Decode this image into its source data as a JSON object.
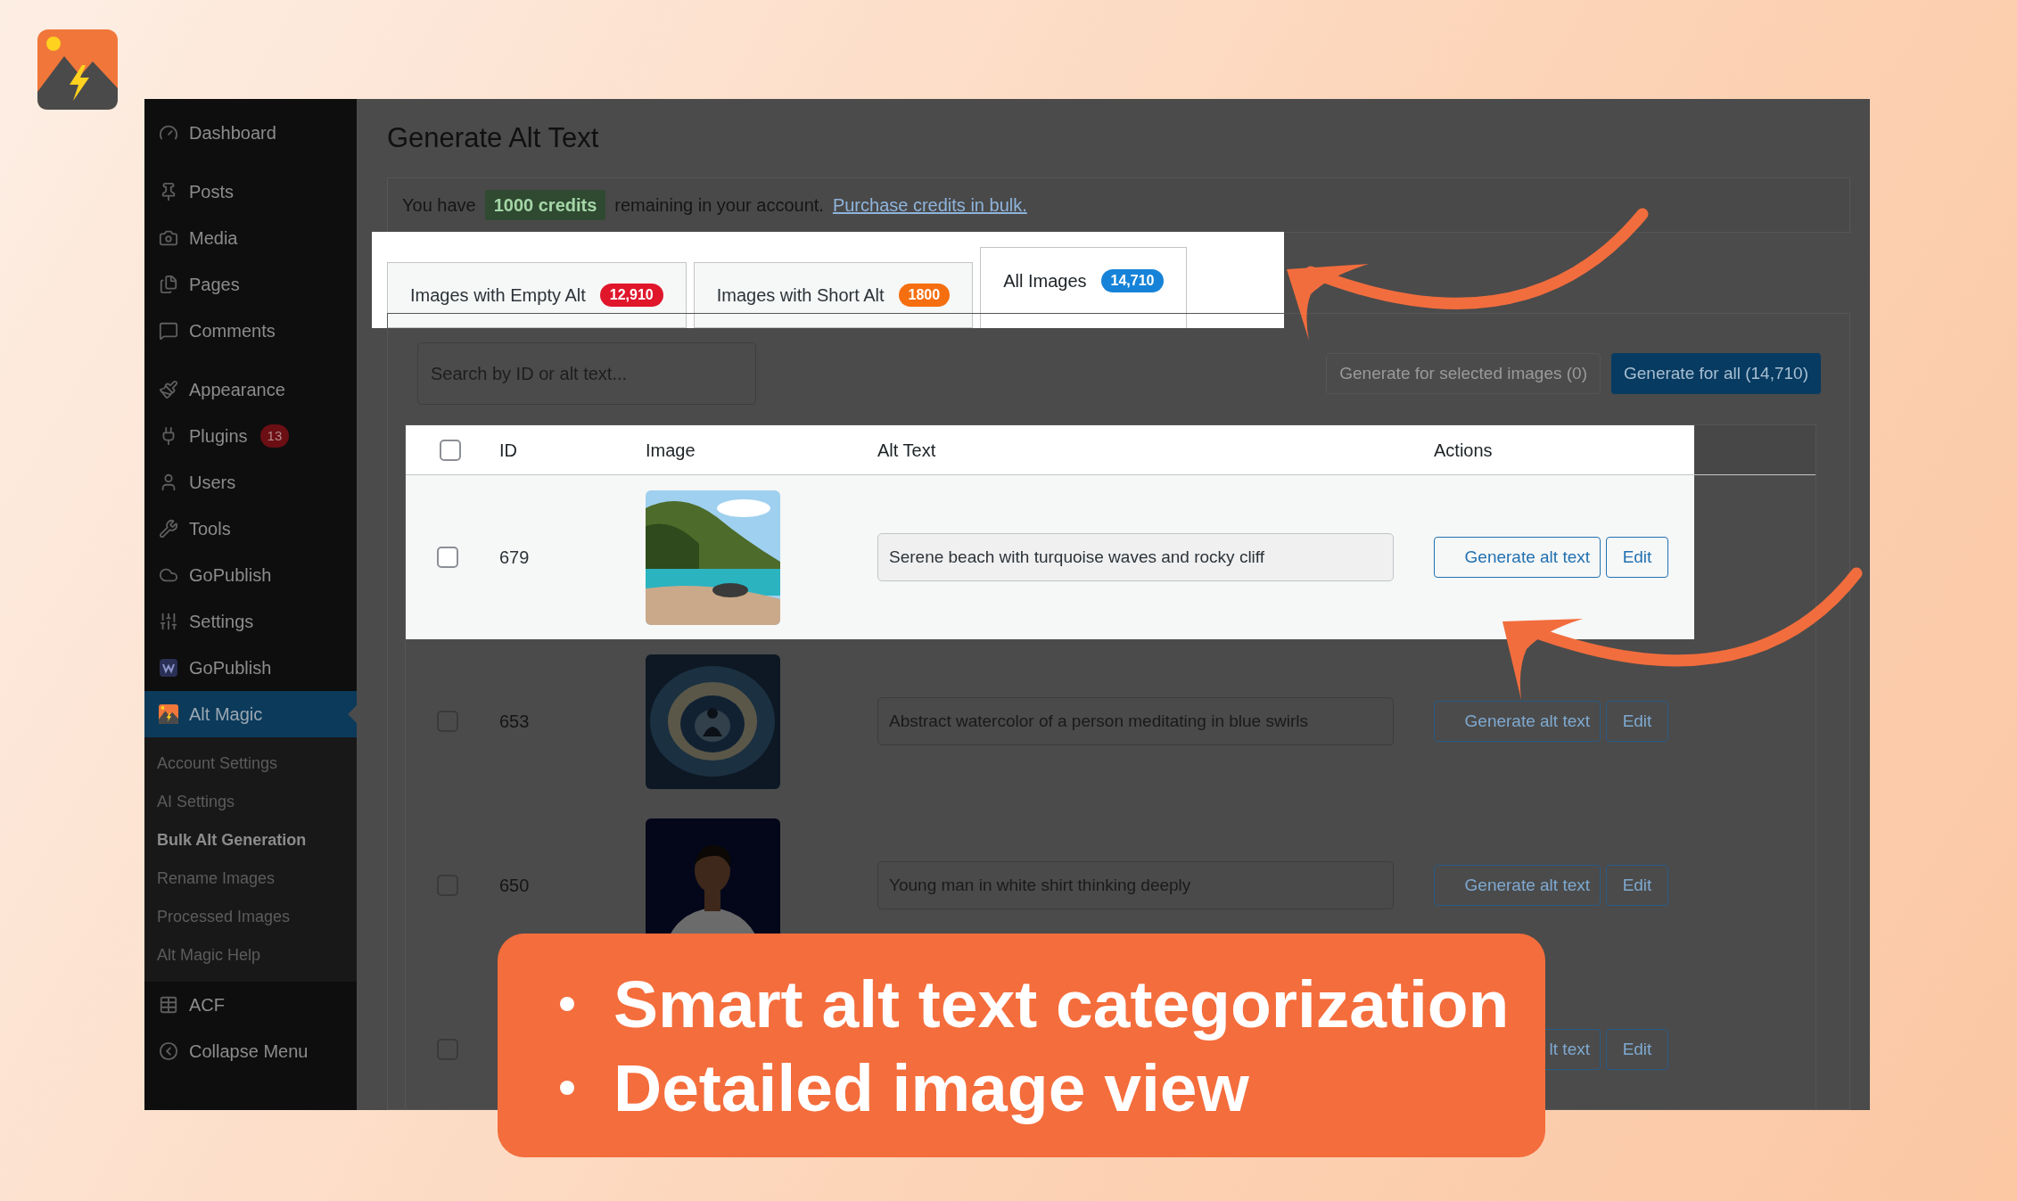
{
  "sidebar": {
    "items": [
      {
        "label": "Dashboard",
        "selected": false
      },
      {
        "label": "Posts",
        "selected": false
      },
      {
        "label": "Media",
        "selected": false
      },
      {
        "label": "Pages",
        "selected": false
      },
      {
        "label": "Comments",
        "selected": false
      },
      {
        "label": "Appearance",
        "selected": false
      },
      {
        "label": "Plugins",
        "selected": false,
        "badge": "13"
      },
      {
        "label": "Users",
        "selected": false
      },
      {
        "label": "Tools",
        "selected": false
      },
      {
        "label": "GoPublish",
        "selected": false
      },
      {
        "label": "Settings",
        "selected": false
      },
      {
        "label": "GoPublish",
        "selected": false
      },
      {
        "label": "Alt Magic",
        "selected": true,
        "submenu": [
          {
            "label": "Account Settings",
            "selected": false
          },
          {
            "label": "AI Settings",
            "selected": false
          },
          {
            "label": "Bulk Alt Generation",
            "selected": true
          },
          {
            "label": "Rename Images",
            "selected": false
          },
          {
            "label": "Processed Images",
            "selected": false
          },
          {
            "label": "Alt Magic Help",
            "selected": false
          }
        ]
      },
      {
        "label": "ACF",
        "selected": false
      },
      {
        "label": "Collapse Menu",
        "selected": false
      }
    ]
  },
  "page": {
    "title": "Generate Alt Text"
  },
  "notice": {
    "before": "You have",
    "credits": "1000 credits",
    "after": "remaining in your account.",
    "link": "Purchase credits in bulk."
  },
  "tabs": {
    "highlighted": true,
    "items": [
      {
        "label": "Images with Empty Alt",
        "count": "12,910",
        "color": "#e0162b",
        "selected": false
      },
      {
        "label": "Images with Short Alt",
        "count": "1800",
        "color": "#f56e0f",
        "selected": false
      },
      {
        "label": "All Images",
        "count": "14,710",
        "color": "#1683d8",
        "selected": true
      }
    ]
  },
  "search": {
    "placeholder": "Search by ID or alt text..."
  },
  "buttons": [
    {
      "label": "Generate for selected images (0)",
      "disabled": true
    },
    {
      "label": "Generate for all (14,710)",
      "disabled": false
    }
  ],
  "table": {
    "columns": [
      "ID",
      "Image",
      "Alt Text",
      "Actions"
    ],
    "header_highlighted": true,
    "header_checked": false,
    "rows": [
      {
        "id": "679",
        "alt": "Serene beach with turquoise waves and rocky cliff",
        "generate": "Generate alt text",
        "edit": "Edit",
        "checked": false,
        "highlighted": true
      },
      {
        "id": "653",
        "alt": "Abstract watercolor of a person meditating in blue swirls",
        "generate": "Generate alt text",
        "edit": "Edit",
        "checked": false,
        "highlighted": false
      },
      {
        "id": "650",
        "alt": "Young man in white shirt thinking deeply",
        "generate": "Generate alt text",
        "edit": "Edit",
        "checked": false,
        "highlighted": false
      },
      {
        "kind": "partial",
        "generate": "lt text",
        "edit": "Edit",
        "checked": false,
        "highlighted": false
      }
    ]
  },
  "callout": {
    "points": [
      "Smart alt text categorization",
      "Detailed image view"
    ]
  }
}
